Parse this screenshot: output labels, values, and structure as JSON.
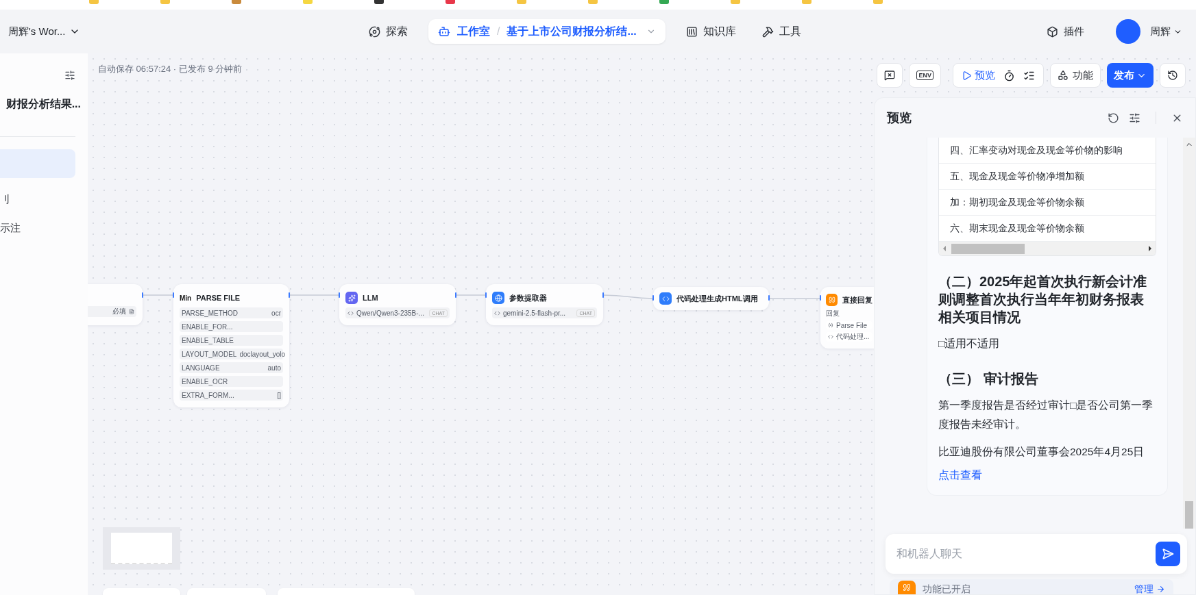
{
  "bookmarks": [
    {
      "color": "#f5c542"
    },
    {
      "color": "#f5c542"
    },
    {
      "color": "#c98a3c"
    },
    {
      "color": "#f5d742"
    },
    {
      "color": "#333333"
    },
    {
      "color": "#e8374a"
    },
    {
      "color": "#f5c542"
    },
    {
      "color": "#f5c542"
    },
    {
      "color": "#34a853"
    },
    {
      "color": "#f5c542"
    },
    {
      "color": "#f5c542"
    },
    {
      "color": "#f5c542"
    }
  ],
  "workspace": {
    "label": "周辉's Wor..."
  },
  "nav": [
    {
      "kind": "link",
      "label": "探索",
      "selected": false
    },
    {
      "kind": "studio",
      "label": "工作室",
      "separator": "/",
      "project": "基于上市公司财报分析结...",
      "selected": true
    },
    {
      "kind": "link",
      "label": "知识库",
      "selected": false
    },
    {
      "kind": "link",
      "label": "工具",
      "selected": false
    }
  ],
  "user": {
    "plugins": "插件",
    "name": "周辉"
  },
  "sidebar": {
    "title": "财报分析结果...",
    "items": [
      {
        "selected": true
      },
      {
        "label": "刂",
        "selected": false
      },
      {
        "label": "示注",
        "selected": false
      }
    ]
  },
  "canvas": {
    "status": "自动保存 06:57:24 · 已发布 9 分钟前",
    "toolbar": {
      "env": "ENV",
      "preview": "预览",
      "features": "功能",
      "publish": "发布"
    },
    "nodes": [
      {
        "kind": "partial",
        "rows": [
          {
            "value": "必填"
          }
        ]
      },
      {
        "kind": "parse",
        "logo": "Min",
        "title": "PARSE FILE",
        "rows": [
          {
            "name": "PARSE_METHOD",
            "value": "ocr"
          },
          {
            "name": "ENABLE_FOR..."
          },
          {
            "name": "ENABLE_TABLE"
          },
          {
            "name": "LAYOUT_MODEL",
            "value": "doclayout_yolo"
          },
          {
            "name": "LANGUAGE",
            "value": "auto"
          },
          {
            "name": "ENABLE_OCR"
          },
          {
            "name": "EXTRA_FORM...",
            "value": "[]"
          }
        ]
      },
      {
        "kind": "llm",
        "title": "LLM",
        "model": "Qwen/Qwen3-235B-...",
        "tag": "CHAT"
      },
      {
        "kind": "extractor",
        "title": "参数提取器",
        "model": "gemini-2.5-flash-pr...",
        "tag": "CHAT"
      },
      {
        "kind": "code",
        "title": "代码处理生成HTML调用"
      },
      {
        "kind": "reply",
        "title": "直接回复",
        "label": "回复",
        "items": [
          "Parse File",
          "代码处理..."
        ]
      }
    ]
  },
  "preview": {
    "title": "预览",
    "table_rows": [
      "四、汇率变动对现金及现金等价物的影响",
      "五、现金及现金等价物净增加额",
      "加：期初现金及现金等价物余额",
      "六、期末现金及现金等价物余额"
    ],
    "blocks": [
      {
        "kind": "heading",
        "text": "（二）2025年起首次执行新会计准则调整首次执行当年年初财务报表相关项目情况"
      },
      {
        "kind": "paragraph",
        "text": "□适用不适用"
      },
      {
        "kind": "heading",
        "text": "（三） 审计报告"
      },
      {
        "kind": "paragraph",
        "text": "第一季度报告是否经过审计□是否公司第一季度报告未经审计。"
      },
      {
        "kind": "paragraph",
        "text": "比亚迪股份有限公司董事会2025年4月25日"
      },
      {
        "kind": "link",
        "text": "点击查看"
      }
    ],
    "chat": {
      "placeholder": "和机器人聊天"
    },
    "footer": {
      "status": "功能已开启",
      "manage": "管理"
    }
  }
}
